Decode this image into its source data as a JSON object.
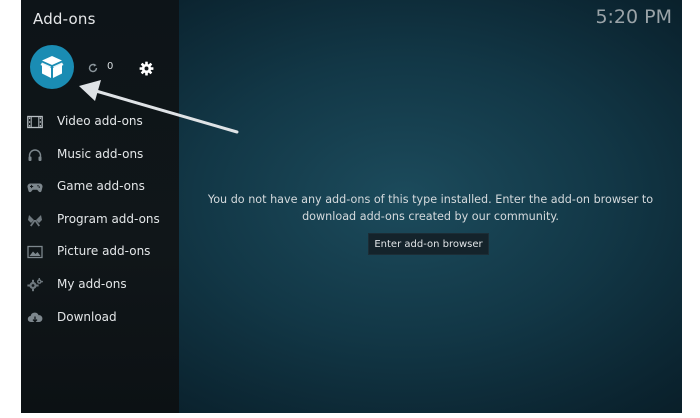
{
  "header": {
    "title": "Add-ons",
    "clock": "5:20 PM"
  },
  "toolbar": {
    "addon_icon": "open-box-icon",
    "refresh_icon": "refresh-icon",
    "update_count": "0",
    "settings_icon": "gear-icon"
  },
  "sidebar": {
    "items": [
      {
        "label": "Video add-ons",
        "icon": "film-icon"
      },
      {
        "label": "Music add-ons",
        "icon": "headphones-icon"
      },
      {
        "label": "Game add-ons",
        "icon": "gamepad-icon"
      },
      {
        "label": "Program add-ons",
        "icon": "puzzle-icon"
      },
      {
        "label": "Picture add-ons",
        "icon": "picture-icon"
      },
      {
        "label": "My add-ons",
        "icon": "gears-icon"
      },
      {
        "label": "Download",
        "icon": "cloud-download-icon"
      }
    ]
  },
  "main": {
    "message_line1": "You do not have any add-ons of this type installed. Enter the add-on browser to",
    "message_line2": "download add-ons created by our community.",
    "browse_button": "Enter add-on browser"
  },
  "colors": {
    "accent": "#1a8cb3",
    "annotation_arrow": "#dfe3e6"
  }
}
